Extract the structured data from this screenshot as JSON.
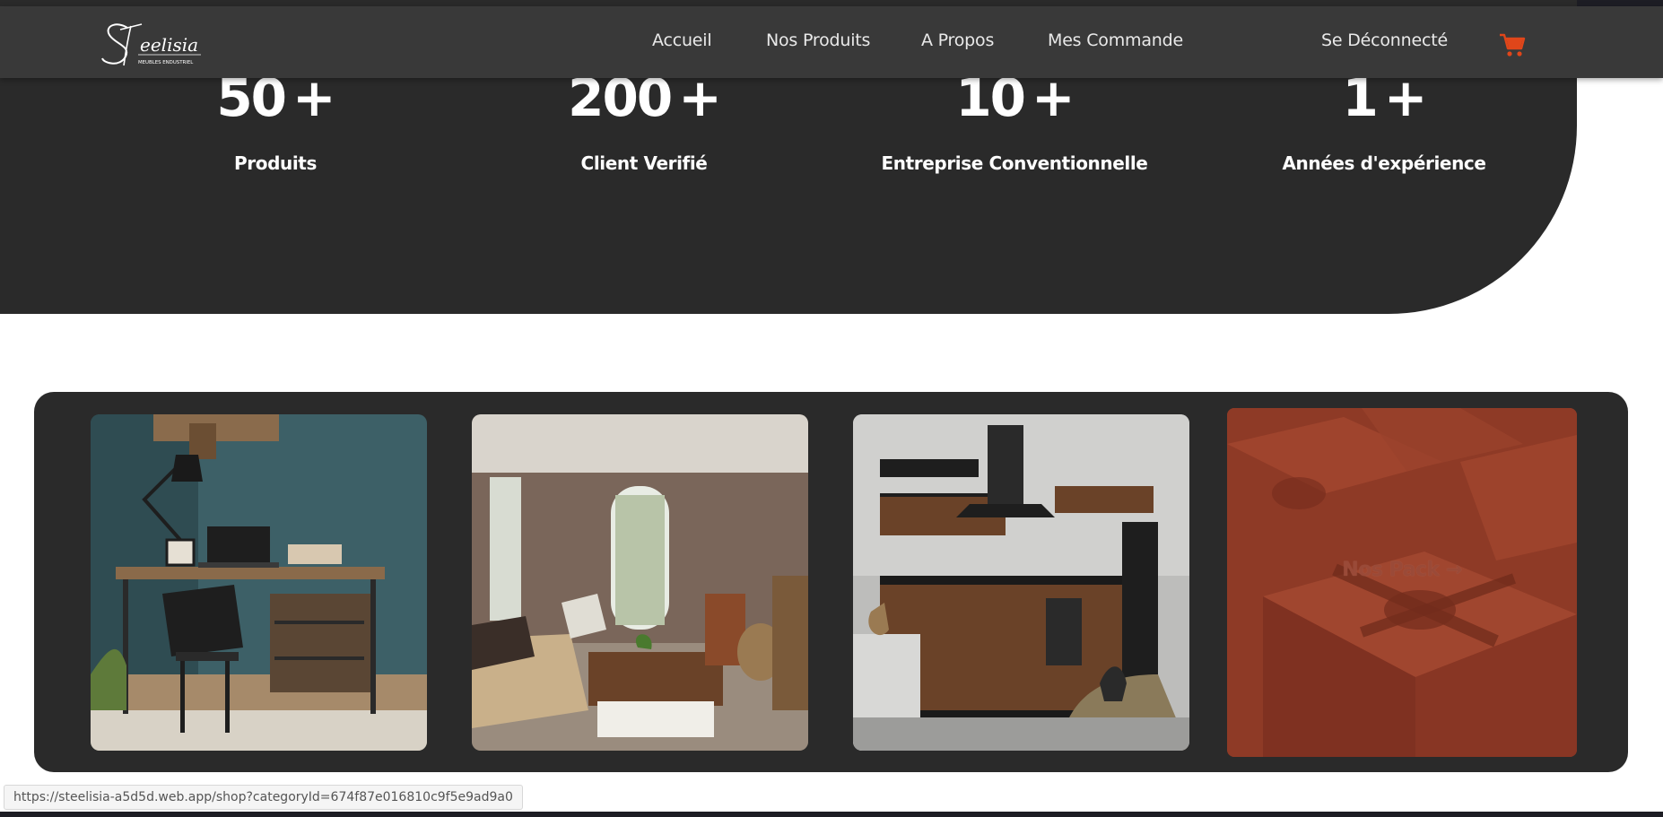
{
  "brand": {
    "logo_text": "Steelisia",
    "logo_tagline": "MEUBLES ENDUSTRIEL"
  },
  "nav": {
    "items": [
      {
        "label": "Accueil"
      },
      {
        "label": "Nos Produits"
      },
      {
        "label": "A Propos"
      },
      {
        "label": "Mes Commande"
      }
    ],
    "logout_label": "Se Déconnecté",
    "cart_icon": "shopping-cart-icon"
  },
  "stats": [
    {
      "value": "50",
      "suffix": "+",
      "label": "Produits"
    },
    {
      "value": "200",
      "suffix": "+",
      "label": "Client Verifié"
    },
    {
      "value": "10",
      "suffix": "+",
      "label": "Entreprise Conventionnelle"
    },
    {
      "value": "1",
      "suffix": "+",
      "label": "Années d'expérience"
    }
  ],
  "categories": [
    {
      "name": "office-desk",
      "image": "industrial desk with lamp and laptop"
    },
    {
      "name": "living-room",
      "image": "living room with sofa and coffee table"
    },
    {
      "name": "kitchen",
      "image": "wood and black kitchen"
    }
  ],
  "pack": {
    "label": "Nos Pack →"
  },
  "status_url": "https://steelisia-a5d5d.web.app/shop?categoryId=674f87e016810c9f5e9ad9a0",
  "colors": {
    "dark": "#2a2a2a",
    "navbar": "#393939",
    "accent_cart": "#e0461a",
    "pack_overlay": "#8e3a26"
  }
}
